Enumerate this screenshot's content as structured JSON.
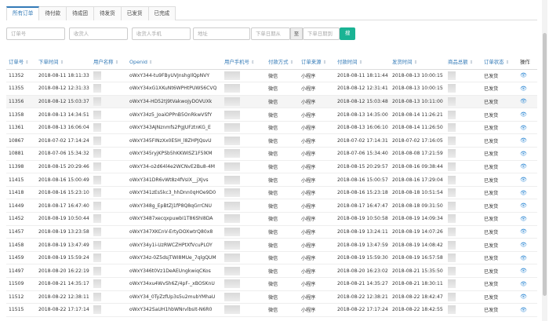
{
  "tabs": [
    "所有订单",
    "待付款",
    "待成团",
    "待发货",
    "已发货",
    "已完成"
  ],
  "filters": {
    "order_no": "订单号",
    "receiver": "收货人",
    "receiver_phone": "收货人手机",
    "address": "地址",
    "date_from": "下单日期从",
    "to_label": "至",
    "date_to": "下单日期到",
    "search_label": "搜索"
  },
  "columns": [
    "订单号",
    "下单时间",
    "用户名称",
    "Openid",
    "用户手机号",
    "付款方式",
    "订单来源",
    "付款时间",
    "发货时间",
    "商品总额",
    "订单状态",
    "操作"
  ],
  "rows": [
    {
      "id": "11352",
      "order_time": "2018-08-11 18:11:33",
      "openid": "oWxY344-tu9FByUVJnshgIlQpNVY",
      "pay": "微信",
      "source": "小程序",
      "pay_time": "2018-08-11 18:11:44",
      "ship_time": "2018-08-13 10:00:15",
      "status": "已发货"
    },
    {
      "id": "11355",
      "order_time": "2018-08-12 12:31:33",
      "openid": "oWxY34xG1XKuNt6WPHtPUWS6CVQ",
      "pay": "微信",
      "source": "小程序",
      "pay_time": "2018-08-12 12:31:41",
      "ship_time": "2018-08-13 10:00:15",
      "status": "已发货"
    },
    {
      "id": "11356",
      "order_time": "2018-08-12 15:03:37",
      "openid": "oWxY34-HD52tj9tVakwoJyDOVUXk",
      "pay": "微信",
      "source": "小程序",
      "pay_time": "2018-08-12 15:03:48",
      "ship_time": "2018-08-13 10:11:00",
      "status": "已发货"
    },
    {
      "id": "11358",
      "order_time": "2018-08-13 14:34:51",
      "openid": "oWxY34z5_JoaiOPPnB5OnRkwVSfY",
      "pay": "微信",
      "source": "小程序",
      "pay_time": "2018-08-13 14:35:00",
      "ship_time": "2018-08-14 11:26:21",
      "status": "已发货"
    },
    {
      "id": "11361",
      "order_time": "2018-08-13 16:06:04",
      "openid": "oWxY343AJNznmfs2PgJUFztnKG_E",
      "pay": "微信",
      "source": "小程序",
      "pay_time": "2018-08-13 16:06:10",
      "ship_time": "2018-08-14 11:26:50",
      "status": "已发货"
    },
    {
      "id": "10867",
      "order_time": "2018-07-02 17:14:24",
      "openid": "oWxY345FINzXx0ESH_l8ZHPJQsvU",
      "pay": "微信",
      "source": "小程序",
      "pay_time": "2018-07-02 17:14:31",
      "ship_time": "2018-07-02 17:16:05",
      "status": "已发货"
    },
    {
      "id": "10881",
      "order_time": "2018-07-06 15:34:32",
      "openid": "oWxY345ryjKPSb5hKKWISZ1F5lKM",
      "pay": "微信",
      "source": "小程序",
      "pay_time": "2018-07-06 15:34:40",
      "ship_time": "2018-08-08 17:21:59",
      "status": "已发货"
    },
    {
      "id": "11398",
      "order_time": "2018-08-15 20:29:46",
      "openid": "oWxY34-o2d64l4e2WCNvE2Bu8-4M",
      "pay": "微信",
      "source": "小程序",
      "pay_time": "2018-08-15 20:29:57",
      "ship_time": "2018-08-16 09:38:44",
      "status": "已发货"
    },
    {
      "id": "11415",
      "order_time": "2018-08-16 15:00:49",
      "openid": "oWxY341DR6vWt8z4fVsIX__jXJvs",
      "pay": "微信",
      "source": "小程序",
      "pay_time": "2018-08-16 15:00:57",
      "ship_time": "2018-08-16 17:29:04",
      "status": "已发货"
    },
    {
      "id": "11418",
      "order_time": "2018-08-16 15:23:10",
      "openid": "oWxY341zEs5kc3_hhDnn0qHOe9D0",
      "pay": "微信",
      "source": "小程序",
      "pay_time": "2018-08-16 15:23:18",
      "ship_time": "2018-08-18 10:51:54",
      "status": "已发货"
    },
    {
      "id": "11449",
      "order_time": "2018-08-17 16:47:40",
      "openid": "oWxY348g_EpBtZJ1fP8Q8qGrrCNU",
      "pay": "微信",
      "source": "小程序",
      "pay_time": "2018-08-17 16:47:47",
      "ship_time": "2018-08-18 09:31:50",
      "status": "已发货"
    },
    {
      "id": "11452",
      "order_time": "2018-08-19 10:50:44",
      "openid": "oWxY3487xecqxpuwbI1T86ShI8DA",
      "pay": "微信",
      "source": "小程序",
      "pay_time": "2018-08-19 10:50:58",
      "ship_time": "2018-08-19 14:09:34",
      "status": "已发货"
    },
    {
      "id": "11457",
      "order_time": "2018-08-19 13:23:58",
      "openid": "oWxY347XKCnV-ErtyDOXwtrQ80x8",
      "pay": "微信",
      "source": "小程序",
      "pay_time": "2018-08-19 13:24:11",
      "ship_time": "2018-08-19 14:07:26",
      "status": "已发货"
    },
    {
      "id": "11458",
      "order_time": "2018-08-19 13:47:49",
      "openid": "oWxY34y1i-UzRWCZHPtXfVcuPLOY",
      "pay": "微信",
      "source": "小程序",
      "pay_time": "2018-08-19 13:47:59",
      "ship_time": "2018-08-19 14:08:42",
      "status": "已发货"
    },
    {
      "id": "11459",
      "order_time": "2018-08-19 15:59:24",
      "openid": "oWxY34z-0Z5dsjTWI8MUe_7qlgQUM",
      "pay": "微信",
      "source": "小程序",
      "pay_time": "2018-08-19 15:59:30",
      "ship_time": "2018-08-19 16:57:58",
      "status": "已发货"
    },
    {
      "id": "11497",
      "order_time": "2018-08-20 16:22:19",
      "openid": "oWxY346t0Vz1DeAEUngkwiqCKos",
      "pay": "微信",
      "source": "小程序",
      "pay_time": "2018-08-20 16:23:02",
      "ship_time": "2018-08-21 15:35:50",
      "status": "已发货"
    },
    {
      "id": "11509",
      "order_time": "2018-08-21 14:35:17",
      "openid": "oWxY34xu4WvSh6Z/4pF-_xBOSKnU",
      "pay": "微信",
      "source": "小程序",
      "pay_time": "2018-08-21 14:35:27",
      "ship_time": "2018-08-21 18:30:11",
      "status": "已发货"
    },
    {
      "id": "11512",
      "order_time": "2018-08-22 12:38:11",
      "openid": "oWxY34_0TyZzfUp3s5u2mubYMhaU",
      "pay": "微信",
      "source": "小程序",
      "pay_time": "2018-08-22 12:38:21",
      "ship_time": "2018-08-22 18:42:47",
      "status": "已发货"
    },
    {
      "id": "11515",
      "order_time": "2018-08-22 17:17:14",
      "openid": "oWxY342SaUH1hbWNrvlbsIt-N6R0",
      "pay": "微信",
      "source": "小程序",
      "pay_time": "2018-08-22 17:17:24",
      "ship_time": "2018-08-22 18:42:55",
      "status": "已发货"
    }
  ]
}
